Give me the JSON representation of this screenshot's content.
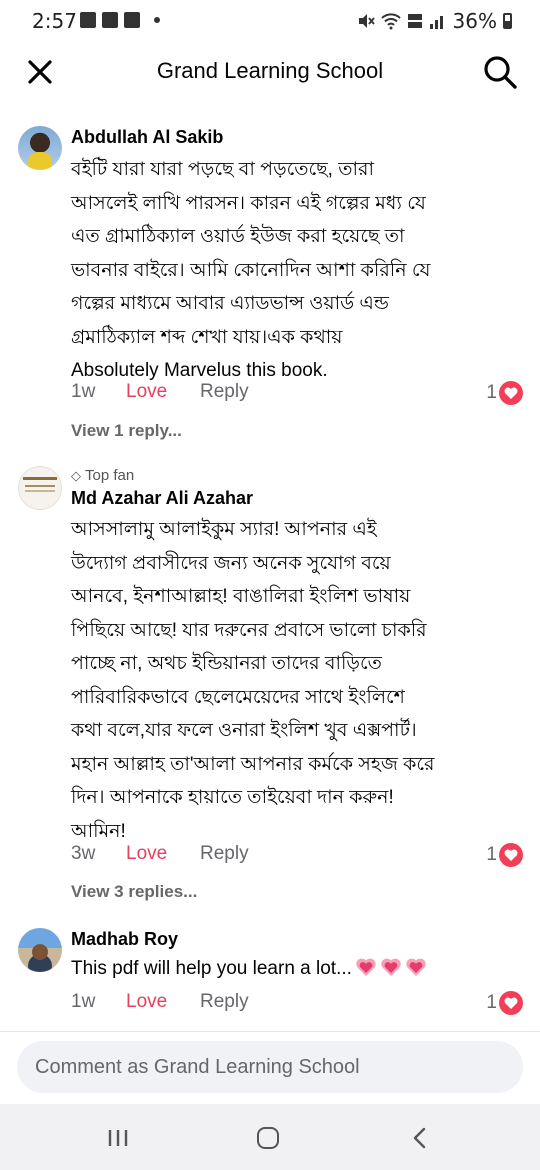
{
  "status_bar": {
    "time": "2:57",
    "battery": "36%"
  },
  "header": {
    "title": "Grand Learning School"
  },
  "comments": [
    {
      "author": "Abdullah Al Sakib",
      "lines": [
        "বইটি যারা যারা পড়ছে বা পড়তেছে, তারা",
        "আসলেই লাখি পারসন। কারন এই গল্পের মধ্য যে",
        "এত গ্রামাঠিক্যাল ওয়ার্ড ইউজ করা হয়েছে তা",
        "ভাবনার বাইরে।  আমি কোনোদিন আশা করিনি যে",
        "গল্পের মাধ্যমে আবার এ্যাডভান্স ওয়ার্ড এন্ড",
        "গ্রমাঠিক্যাল শব্দ শেখা যায়।এক কথায়",
        "Absolutely Marvelus this book."
      ],
      "time": "1w",
      "love_label": "Love",
      "reply_label": "Reply",
      "reaction_count": "1",
      "view_replies": "View 1 reply..."
    },
    {
      "badge": "Top fan",
      "author": "Md Azahar Ali Azahar",
      "lines": [
        "আসসালামু আলাইকুম স্যার! আপনার এই",
        "উদ্যোগ প্রবাসীদের জন্য অনেক সুযোগ বয়ে",
        "আনবে, ইনশাআল্লাহ! বাঙালিরা ইংলিশ ভাষায়",
        "পিছিয়ে আছে!  যার দরুনের প্রবাসে ভালো চাকরি",
        "পাচ্ছে না, অথচ ইন্ডিয়ানরা তাদের বাড়িতে",
        "পারিবারিকভাবে ছেলেমেয়েদের সাথে ইংলিশে",
        "কথা বলে,যার ফলে ওনারা ইংলিশ খুব  এক্সপার্ট।",
        "মহান আল্লাহ তা'আলা আপনার কর্মকে সহজ করে",
        "দিন। আপনাকে হায়াতে  তাইয়েবা দান করুন!",
        "আমিন!"
      ],
      "time": "3w",
      "love_label": "Love",
      "reply_label": "Reply",
      "reaction_count": "1",
      "view_replies": "View 3 replies..."
    },
    {
      "author": "Madhab Roy",
      "text": "This pdf will help you learn a lot...",
      "emoji_icons": [
        "heart-with-ribbon-icon",
        "heart-with-ribbon-icon",
        "heart-with-ribbon-icon"
      ],
      "time": "1w",
      "love_label": "Love",
      "reply_label": "Reply",
      "reaction_count": "1"
    }
  ],
  "composer": {
    "placeholder": "Comment as Grand Learning School"
  },
  "colors": {
    "love": "#e4405f",
    "muted": "#65676b",
    "reaction_heart": "#f33e58",
    "composer_bg": "#f0f2f5"
  }
}
